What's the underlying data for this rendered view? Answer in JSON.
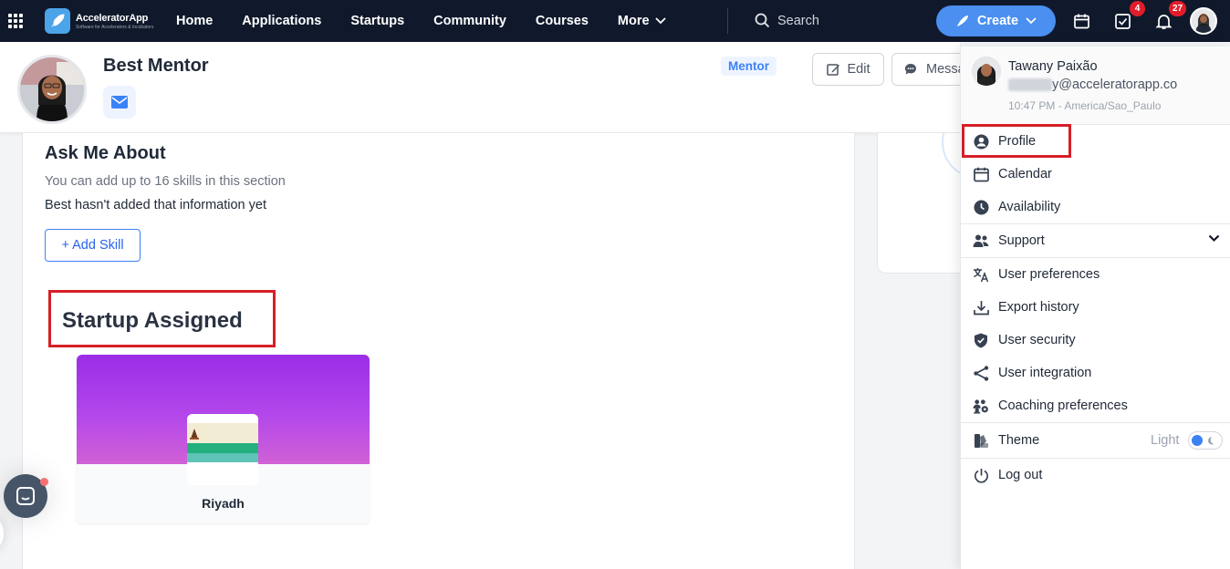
{
  "navbar": {
    "logo_name": "AcceleratorApp",
    "logo_tag": "Software for Accelerators & Incubators",
    "links": [
      "Home",
      "Applications",
      "Startups",
      "Community",
      "Courses",
      "More"
    ],
    "search_label": "Search",
    "create_label": "Create",
    "tasks_count": "4",
    "notifications_count": "27"
  },
  "profile": {
    "name": "Best Mentor",
    "role": "Mentor",
    "edit_label": "Edit",
    "message_label": "Message"
  },
  "ask": {
    "title": "Ask Me About",
    "subtitle": "You can add up to 16 skills in this section",
    "empty": "Best hasn't added that information yet",
    "add_skill": "+ Add Skill"
  },
  "startups": {
    "title": "Startup Assigned",
    "items": [
      {
        "name": "Riyadh"
      }
    ]
  },
  "dropdown": {
    "user_name": "Tawany Paixão",
    "email_suffix": "y@acceleratorapp.co",
    "time": "10:47 PM - America/Sao_Paulo",
    "items": {
      "profile": "Profile",
      "calendar": "Calendar",
      "availability": "Availability",
      "support": "Support",
      "user_preferences": "User preferences",
      "export_history": "Export history",
      "user_security": "User security",
      "user_integration": "User integration",
      "coaching_preferences": "Coaching preferences",
      "theme": "Theme",
      "logout": "Log out"
    },
    "theme_value": "Light"
  },
  "colors": {
    "navbar_bg": "#10192b",
    "accent": "#4b8ff0",
    "highlight_box": "#d61f26",
    "badge": "#e11d2a"
  }
}
